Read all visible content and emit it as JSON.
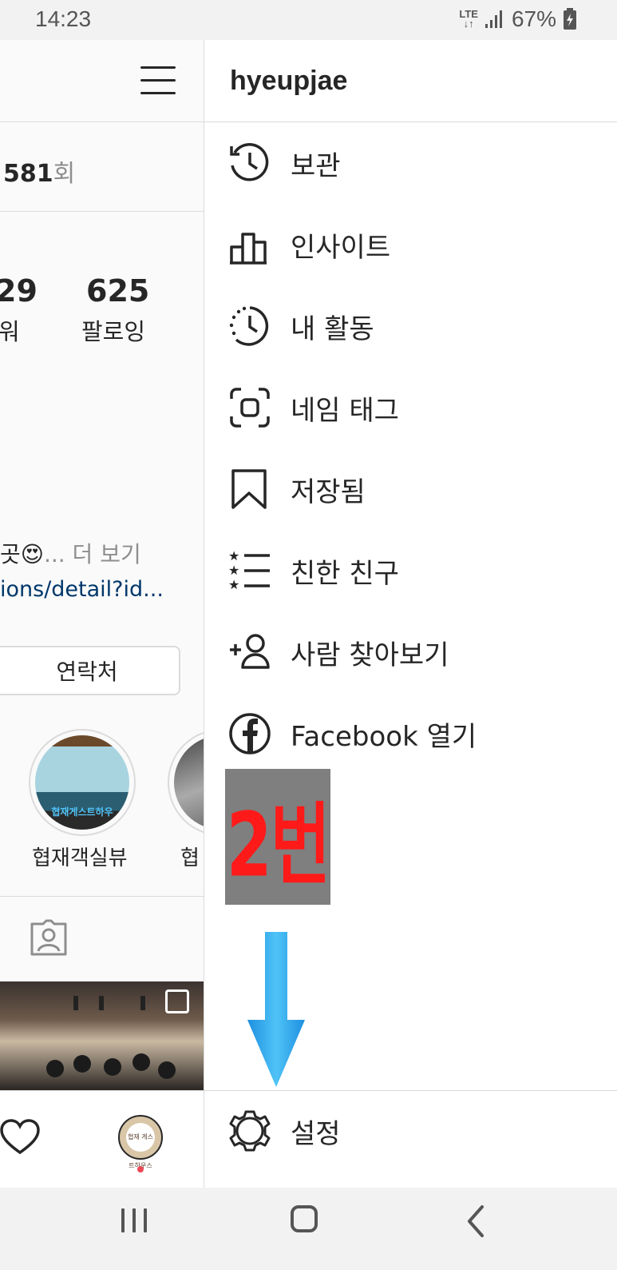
{
  "status_bar": {
    "time": "14:23",
    "network": "LTE",
    "battery": "67%"
  },
  "profile": {
    "views_count": "581",
    "views_unit": "회",
    "followers_count": "29",
    "followers_label": "워",
    "following_count": "625",
    "following_label": "팔로잉",
    "bio_text": "곳😍",
    "bio_more": "... 더 보기",
    "bio_link": "ions/detail?id...",
    "contact_button": "연락처",
    "highlights": [
      {
        "label": "협재객실뷰",
        "image_text": "협재게스트하우"
      },
      {
        "label": "협"
      }
    ],
    "nav_avatar_text": "협재 게스트하우스"
  },
  "drawer": {
    "username": "hyeupjae",
    "items": [
      {
        "label": "보관",
        "icon": "archive-history-icon"
      },
      {
        "label": "인사이트",
        "icon": "insights-bar-chart-icon"
      },
      {
        "label": "내 활동",
        "icon": "your-activity-icon"
      },
      {
        "label": "네임 태그",
        "icon": "nametag-icon"
      },
      {
        "label": "저장됨",
        "icon": "bookmark-icon"
      },
      {
        "label": "친한 친구",
        "icon": "close-friends-list-icon"
      },
      {
        "label": "사람 찾아보기",
        "icon": "discover-people-icon"
      },
      {
        "label": "Facebook 열기",
        "icon": "facebook-icon"
      }
    ],
    "annotation_badge": "2번",
    "settings_label": "설정"
  },
  "colors": {
    "badge_text": "#ff1a1a",
    "badge_bg": "#7f7f7f",
    "arrow": "#29a9f0",
    "link": "#00376b"
  }
}
